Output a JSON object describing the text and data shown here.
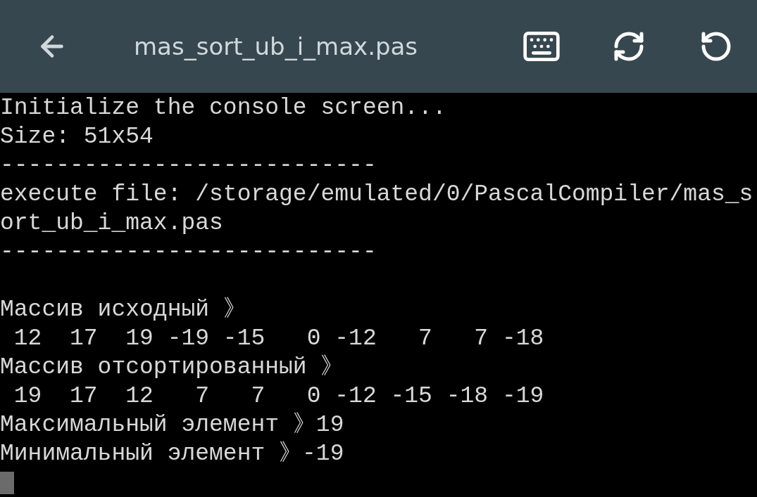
{
  "toolbar": {
    "title": "mas_sort_ub_i_max.pas"
  },
  "console": {
    "lines": [
      {
        "kind": "text",
        "text": "Initialize the console screen..."
      },
      {
        "kind": "text",
        "text": "Size: 51x54"
      },
      {
        "kind": "text",
        "text": "---------------------------"
      },
      {
        "kind": "text",
        "text": "execute file: /storage/emulated/0/PascalCompiler/mas_s"
      },
      {
        "kind": "text",
        "text": "ort_ub_i_max.pas"
      },
      {
        "kind": "text",
        "text": "---------------------------"
      },
      {
        "kind": "blank"
      },
      {
        "kind": "text",
        "text": "Массив исходный 》"
      },
      {
        "kind": "text",
        "text": " 12  17  19 -19 -15   0 -12   7   7 -18"
      },
      {
        "kind": "text",
        "text": "Массив отсортированный 》"
      },
      {
        "kind": "text",
        "text": " 19  17  12   7   7   0 -12 -15 -18 -19"
      },
      {
        "kind": "text",
        "text": "Максимальный элемент 》19"
      },
      {
        "kind": "text",
        "text": "Минимальный элемент 》-19"
      },
      {
        "kind": "cursor"
      }
    ]
  }
}
